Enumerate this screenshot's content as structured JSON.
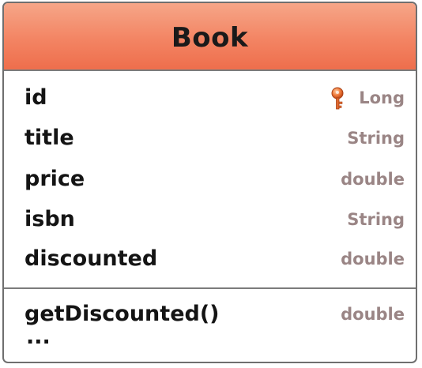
{
  "class": {
    "name": "Book",
    "header_color": "#f38463",
    "attributes": [
      {
        "name": "id",
        "type": "Long",
        "primary_key": true
      },
      {
        "name": "title",
        "type": "String"
      },
      {
        "name": "price",
        "type": "double"
      },
      {
        "name": "isbn",
        "type": "String"
      },
      {
        "name": "discounted",
        "type": "double"
      }
    ],
    "operations": [
      {
        "name": "getDiscounted()",
        "type": "double"
      }
    ],
    "more_operations": "..."
  },
  "icons": {
    "primary_key": "key-icon"
  }
}
